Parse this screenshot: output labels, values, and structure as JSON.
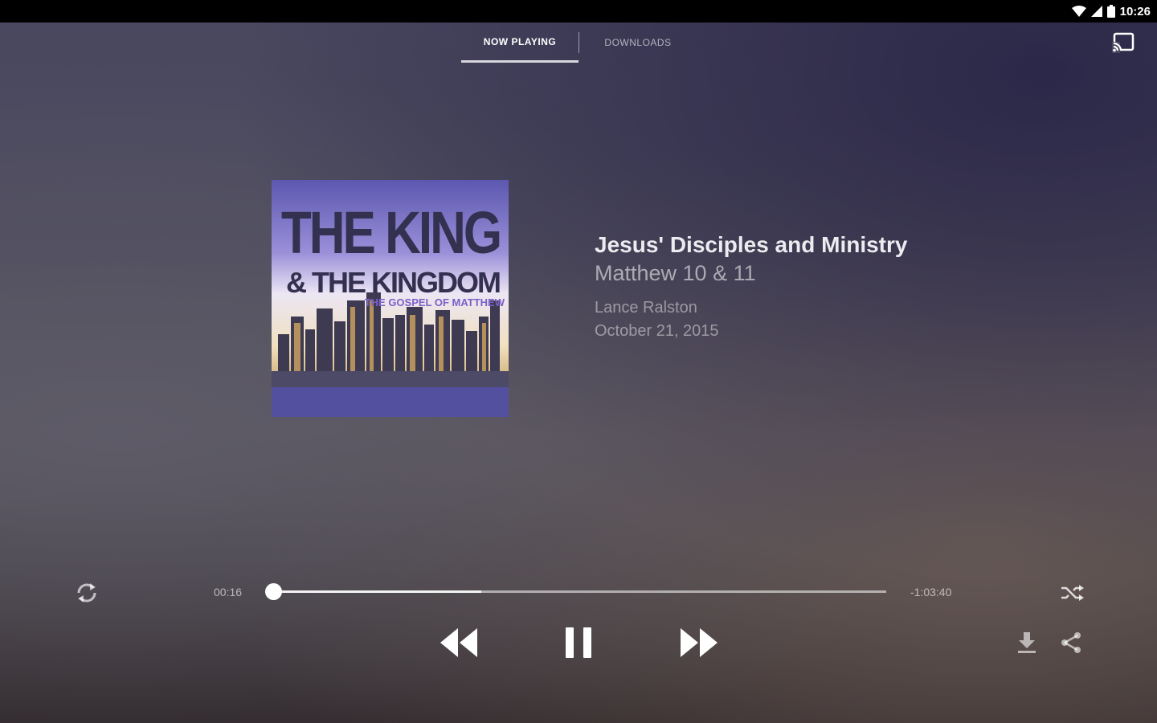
{
  "status_bar": {
    "time": "10:26"
  },
  "tabs": [
    {
      "label": "NOW PLAYING",
      "active": true
    },
    {
      "label": "DOWNLOADS",
      "active": false
    }
  ],
  "album_art": {
    "title": "THE KING",
    "subtitle": "& THE KINGDOM",
    "tagline": "THE GOSPEL OF MATTHEW"
  },
  "track": {
    "title": "Jesus' Disciples and Ministry",
    "passage": "Matthew 10 & 11",
    "speaker": "Lance Ralston",
    "date": "October 21, 2015"
  },
  "playback": {
    "elapsed": "00:16",
    "remaining": "-1:03:40",
    "progress_fraction": 0.0,
    "buffered_fraction": 0.34,
    "state": "playing"
  },
  "icons": {
    "cast": "cast-icon",
    "repeat": "repeat-icon",
    "shuffle": "shuffle-icon",
    "rewind": "rewind-icon",
    "pause": "pause-icon",
    "fast_forward": "fast-forward-icon",
    "download": "download-icon",
    "share": "share-icon"
  },
  "colors": {
    "accent": "#d8d6dc",
    "status_bar": "#000000",
    "art_background": "#5a56a8",
    "art_text": "#34304f"
  }
}
